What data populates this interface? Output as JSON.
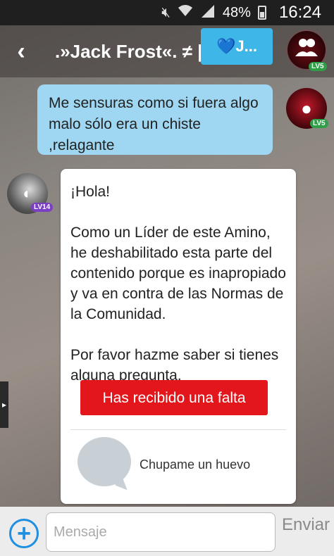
{
  "status_bar": {
    "battery": "48%",
    "time": "16:24",
    "icons": [
      "mute-icon",
      "wifi-icon",
      "signal-icon",
      "battery-icon"
    ]
  },
  "header": {
    "title": ".»Jack Frost«. ≠ |",
    "tooltip": "💙J...",
    "avatar_level": "LV5"
  },
  "messages": {
    "outgoing": {
      "text": "Me sensuras como si fuera algo malo sólo era un chiste ,relagante",
      "avatar_level": "LV5"
    },
    "incoming": {
      "avatar_level": "LV14",
      "greeting": "¡Hola!",
      "body": "Como un Líder de este Amino, he deshabilitado esta parte del contenido porque es inapropiado y va en contra de las Normas de la Comunidad.",
      "closing": "Por favor hazme saber si tienes alguna pregunta.",
      "warning_button": "Has recibido una falta",
      "quote_text": "Chupame un huevo"
    }
  },
  "composer": {
    "placeholder": "Mensaje",
    "send_label": "Enviar"
  },
  "colors": {
    "accent": "#1e8fe1",
    "outgoing_bubble": "#9fd7f2",
    "warning": "#e3161c"
  }
}
